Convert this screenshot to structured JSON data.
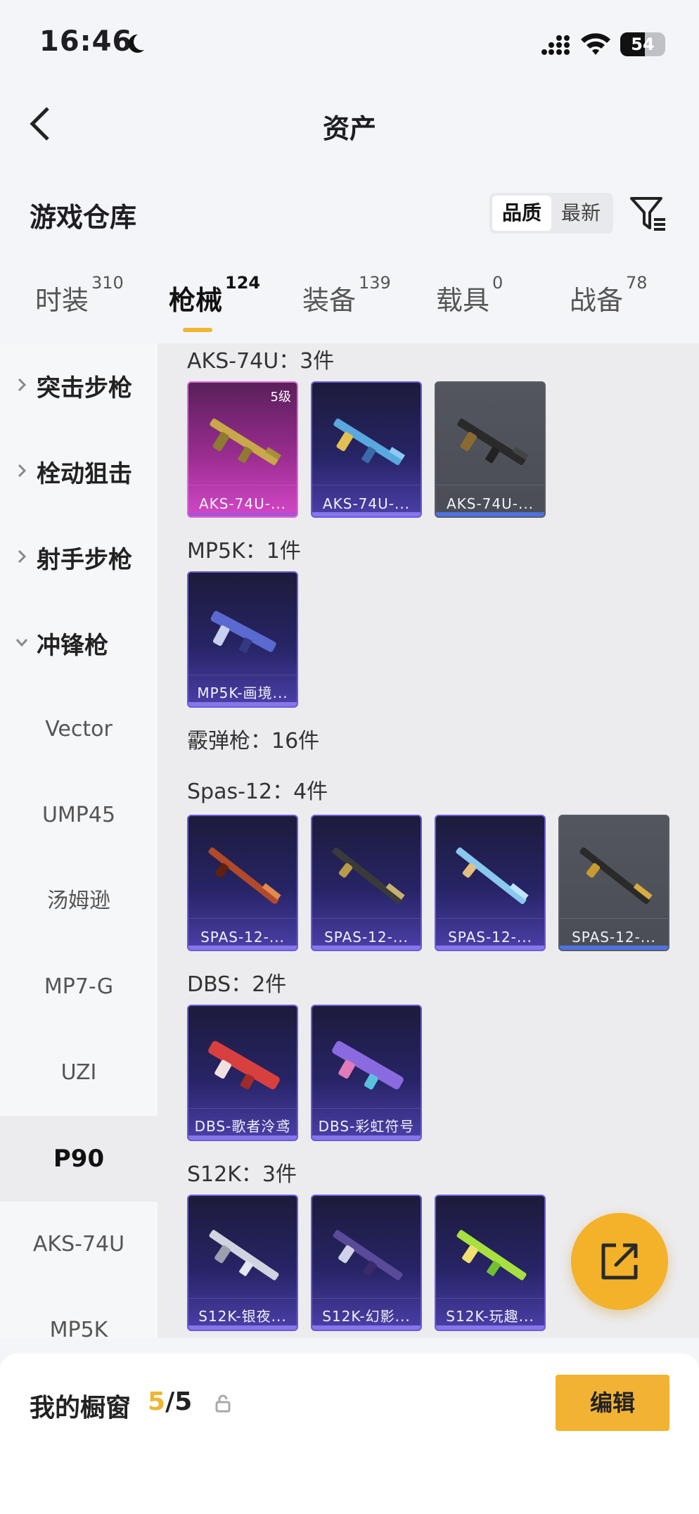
{
  "status_bar": {
    "time": "16:46",
    "battery": "54"
  },
  "nav": {
    "title": "资产"
  },
  "header": {
    "title": "游戏仓库",
    "sort_quality": "品质",
    "sort_latest": "最新"
  },
  "tabs": [
    {
      "label": "时装",
      "count": "310"
    },
    {
      "label": "枪械",
      "count": "124"
    },
    {
      "label": "装备",
      "count": "139"
    },
    {
      "label": "载具",
      "count": "0"
    },
    {
      "label": "战备",
      "count": "78"
    }
  ],
  "sidebar": {
    "categories": [
      "突击步枪",
      "栓动狙击",
      "射手步枪",
      "冲锋枪"
    ],
    "subs": [
      "Vector",
      "UMP45",
      "汤姆逊",
      "MP7-G",
      "UZI",
      "P90",
      "AKS-74U",
      "MP5K"
    ]
  },
  "content": {
    "groups": [
      {
        "title": "AKS-74U：3件"
      },
      {
        "title": "MP5K：1件"
      },
      {
        "title": "霰弹枪：16件"
      },
      {
        "title": "Spas-12：4件"
      },
      {
        "title": "DBS：2件"
      },
      {
        "title": "S12K：3件"
      }
    ],
    "cards": [
      {
        "name": "AKS-74U-...",
        "level": "5级"
      },
      {
        "name": "AKS-74U-..."
      },
      {
        "name": "AKS-74U-..."
      },
      {
        "name": "MP5K-画境..."
      },
      {
        "name": "SPAS-12-..."
      },
      {
        "name": "SPAS-12-..."
      },
      {
        "name": "SPAS-12-..."
      },
      {
        "name": "SPAS-12-..."
      },
      {
        "name": "DBS-歌者泠鸢"
      },
      {
        "name": "DBS-彩虹符号"
      },
      {
        "name": "S12K-银夜..."
      },
      {
        "name": "S12K-幻影..."
      },
      {
        "name": "S12K-玩趣..."
      }
    ]
  },
  "showcase": {
    "label": "我的橱窗",
    "current": "5",
    "total": "/5",
    "edit_label": "编辑"
  },
  "colors": {
    "accent": "#f0b532",
    "page_bg": "#f4f5f8"
  },
  "icons": [
    "moon-icon",
    "signal-icon",
    "wifi-icon",
    "back-arrow-icon",
    "filter-icon",
    "chevron-right-icon",
    "chevron-down-icon",
    "share-icon",
    "lock-icon"
  ]
}
